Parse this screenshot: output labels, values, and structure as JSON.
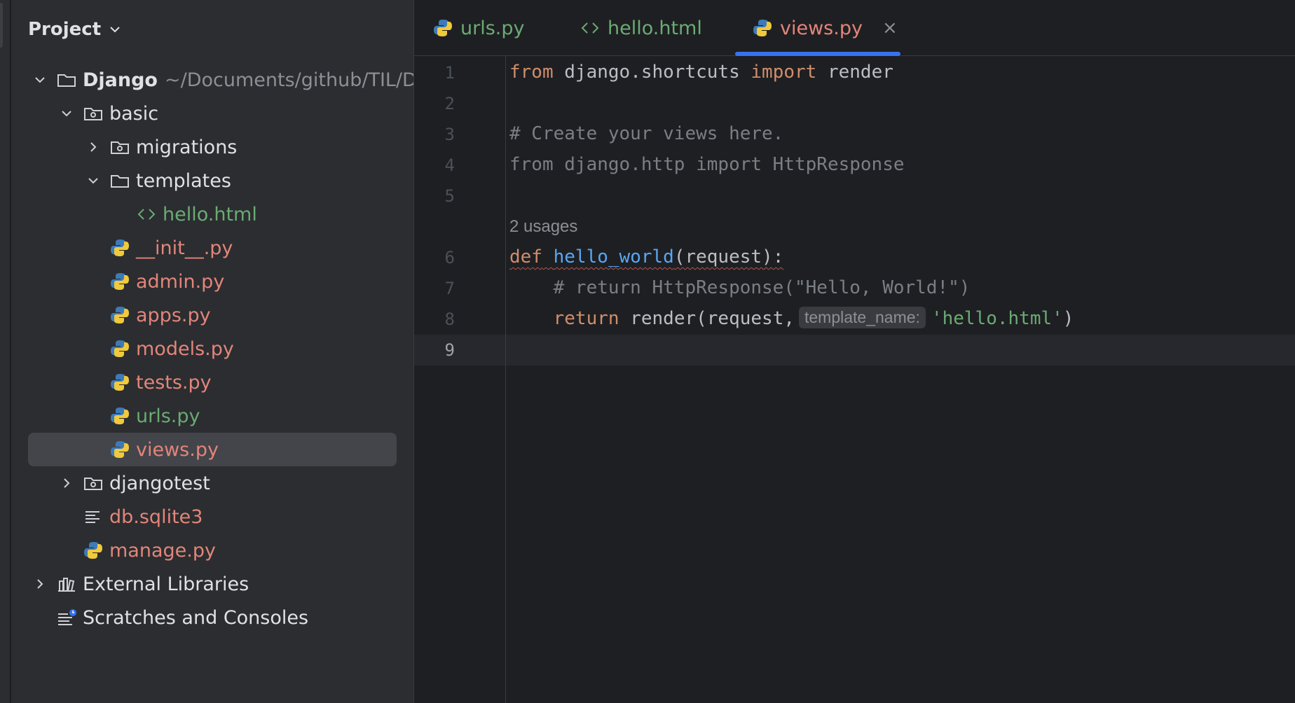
{
  "project_panel": {
    "title": "Project",
    "tree": [
      {
        "label": "Django",
        "path": "~/Documents/github/TIL/Django",
        "expanded": true,
        "type": "root-folder",
        "color": "#dfe1e5"
      },
      {
        "label": "basic",
        "expanded": true,
        "type": "module-folder",
        "color": "#dfe1e5"
      },
      {
        "label": "migrations",
        "expanded": false,
        "type": "module-folder",
        "color": "#dfe1e5"
      },
      {
        "label": "templates",
        "expanded": true,
        "type": "folder",
        "color": "#dfe1e5"
      },
      {
        "label": "hello.html",
        "type": "html-file",
        "color": "#6aab73"
      },
      {
        "label": "__init__.py",
        "type": "python-file",
        "color": "#e3857a"
      },
      {
        "label": "admin.py",
        "type": "python-file",
        "color": "#e3857a"
      },
      {
        "label": "apps.py",
        "type": "python-file",
        "color": "#e3857a"
      },
      {
        "label": "models.py",
        "type": "python-file",
        "color": "#e3857a"
      },
      {
        "label": "tests.py",
        "type": "python-file",
        "color": "#e3857a"
      },
      {
        "label": "urls.py",
        "type": "python-file",
        "color": "#6aab73"
      },
      {
        "label": "views.py",
        "type": "python-file",
        "color": "#e3857a",
        "selected": true
      },
      {
        "label": "djangotest",
        "expanded": false,
        "type": "module-folder",
        "color": "#dfe1e5"
      },
      {
        "label": "db.sqlite3",
        "type": "text-file",
        "color": "#e3857a"
      },
      {
        "label": "manage.py",
        "type": "python-file",
        "color": "#e3857a"
      },
      {
        "label": "External Libraries",
        "expanded": false,
        "type": "libraries",
        "color": "#dfe1e5"
      },
      {
        "label": "Scratches and Consoles",
        "type": "scratches",
        "color": "#dfe1e5"
      }
    ]
  },
  "tabs": [
    {
      "label": "urls.py",
      "icon": "python-icon",
      "color": "#6aab73"
    },
    {
      "label": "hello.html",
      "icon": "html-icon",
      "color": "#6aab73"
    },
    {
      "label": "views.py",
      "icon": "python-icon",
      "color": "#e3857a",
      "active": true,
      "close": "×"
    }
  ],
  "editor": {
    "line_numbers": [
      "1",
      "2",
      "3",
      "4",
      "5",
      "6",
      "7",
      "8",
      "9"
    ],
    "active_line": "9",
    "usages_hint": "2 usages",
    "code": {
      "l1": {
        "kw1": "from",
        "mod": " django.shortcuts ",
        "kw2": "import",
        "name": " render"
      },
      "l3": "# Create your views here.",
      "l4": "from django.http import HttpResponse",
      "l6": {
        "kw": "def",
        "fn": "hello_world",
        "rest": "(request):"
      },
      "l7": "    # return HttpResponse(\"Hello, World!\")",
      "l8": {
        "indent": "    ",
        "kw": "return",
        "call": " render(request,",
        "hint": "template_name:",
        "str": "'hello.html'",
        "close": ")"
      }
    }
  }
}
